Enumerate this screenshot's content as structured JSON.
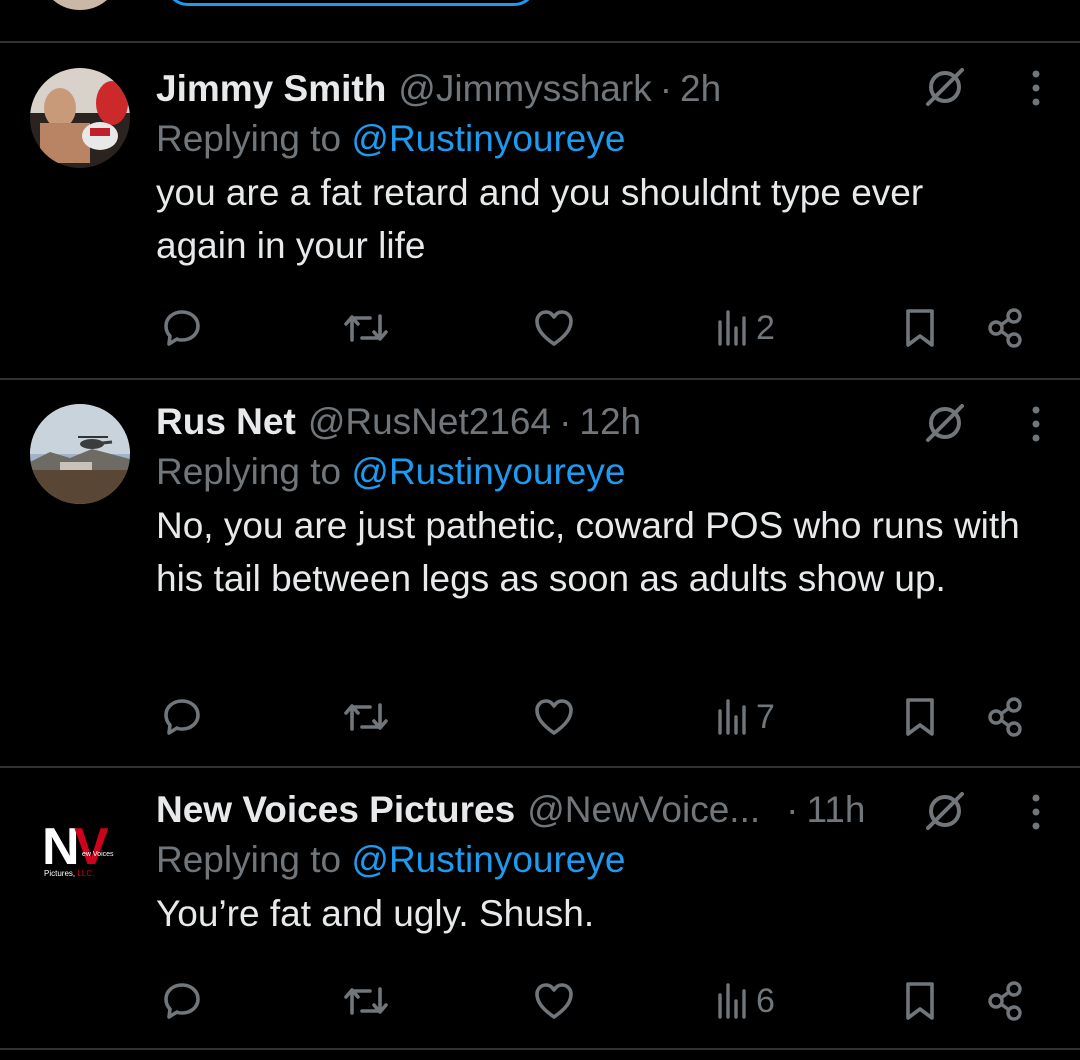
{
  "tweets": [
    {
      "display_name": "Jimmy Smith",
      "handle": "@Jimmysshark",
      "time": "2h",
      "reply_prefix": "Replying to",
      "reply_to": "@Rustinyoureye",
      "text": "you are a fat retard and you shouldnt type ever again in your life",
      "views": "2",
      "avatar": "boxer-photo"
    },
    {
      "display_name": "Rus Net",
      "handle": "@RusNet2164",
      "time": "12h",
      "reply_prefix": "Replying to",
      "reply_to": "@Rustinyoureye",
      "text": "No, you are just pathetic, coward POS who runs with his tail between legs as soon as adults show up.",
      "views": "7",
      "avatar": "helicopter-photo"
    },
    {
      "display_name": "New Voices Pictures",
      "handle": "@NewVoice...",
      "time": "11h",
      "reply_prefix": "Replying to",
      "reply_to": "@Rustinyoureye",
      "text": "You’re fat and ugly. Shush.",
      "views": "6",
      "avatar": "nv-logo",
      "avatar_logo": {
        "mark": "NV",
        "small_text": "ew Voices",
        "caption": "Pictures, LLC."
      }
    }
  ],
  "separator": "·",
  "icons": [
    "reply-icon",
    "retweet-icon",
    "like-icon",
    "views-icon",
    "bookmark-icon",
    "share-icon",
    "grok-icon",
    "more-icon"
  ],
  "colors": {
    "background": "#000000",
    "text": "#e7e9ea",
    "muted": "#71767b",
    "accent": "#1d9bf0",
    "divider": "#2f3336",
    "logo_red": "#d0021b"
  }
}
